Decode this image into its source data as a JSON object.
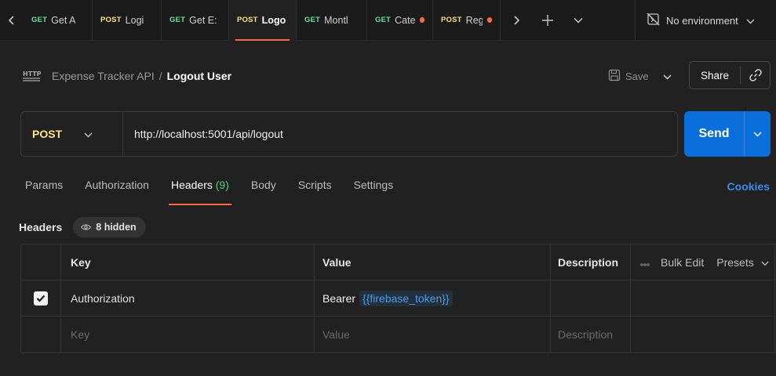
{
  "tabs": [
    {
      "method": "GET",
      "name": "Get A",
      "width": 88
    },
    {
      "method": "POST",
      "name": "Logi",
      "width": 88
    },
    {
      "method": "GET",
      "name": "Get E:",
      "width": 86
    },
    {
      "method": "POST",
      "name": "Logo",
      "width": 86,
      "active": true
    },
    {
      "method": "GET",
      "name": "Montl",
      "width": 90
    },
    {
      "method": "GET",
      "name": "Categ",
      "width": 84,
      "unsaved": true
    },
    {
      "method": "POST",
      "name": "Reg",
      "width": 86,
      "unsaved": true
    }
  ],
  "environment": {
    "label": "No environment"
  },
  "breadcrumb": {
    "collection": "Expense Tracker API",
    "separator": "/",
    "current": "Logout User"
  },
  "toolbar": {
    "save_label": "Save",
    "share_label": "Share"
  },
  "request": {
    "method": "POST",
    "url": "http://localhost:5001/api/logout",
    "send_label": "Send"
  },
  "request_tabs": [
    {
      "label": "Params"
    },
    {
      "label": "Authorization"
    },
    {
      "label": "Headers",
      "count": "(9)",
      "active": true
    },
    {
      "label": "Body"
    },
    {
      "label": "Scripts"
    },
    {
      "label": "Settings"
    }
  ],
  "cookies_label": "Cookies",
  "headers_section": {
    "title": "Headers",
    "hidden_label": "8 hidden"
  },
  "table": {
    "columns": {
      "key": "Key",
      "value": "Value",
      "description": "Description",
      "bulk_edit": "Bulk Edit",
      "presets": "Presets"
    },
    "rows": [
      {
        "checked": true,
        "key": "Authorization",
        "value_prefix": "Bearer",
        "value_var": "{{firebase_token}}",
        "description": ""
      }
    ],
    "placeholders": {
      "key": "Key",
      "value": "Value",
      "description": "Description"
    }
  },
  "colors": {
    "accent": "#ff6c37",
    "send": "#0a6fdb",
    "get": "#6bdd9a",
    "post": "#ffe47e",
    "variable": "#4b9bf0"
  }
}
